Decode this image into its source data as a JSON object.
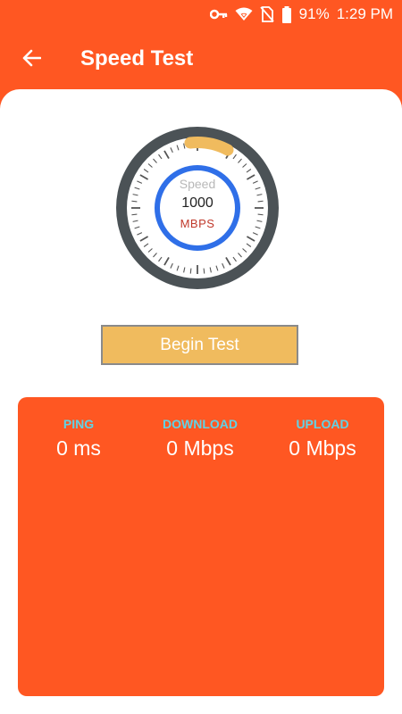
{
  "status_bar": {
    "battery_percent": "91%",
    "time": "1:29 PM",
    "icons": [
      "key-icon",
      "wifi-icon",
      "no-sim-icon",
      "battery-icon"
    ]
  },
  "app_bar": {
    "title": "Speed Test",
    "back_icon": "arrow-back-icon"
  },
  "gauge": {
    "label": "Speed",
    "value": "1000",
    "unit": "MBPS"
  },
  "begin_button": {
    "label": "Begin Test"
  },
  "results": {
    "ping": {
      "label": "PING",
      "value": "0 ms"
    },
    "download": {
      "label": "DOWNLOAD",
      "value": "0 Mbps"
    },
    "upload": {
      "label": "UPLOAD",
      "value": "0 Mbps"
    }
  },
  "colors": {
    "primary": "#ff5722",
    "button": "#f0bb5e",
    "metric_label": "#5fd3e6",
    "gauge_ring": "#2f6fe8",
    "gauge_bezel": "#4b5256"
  }
}
